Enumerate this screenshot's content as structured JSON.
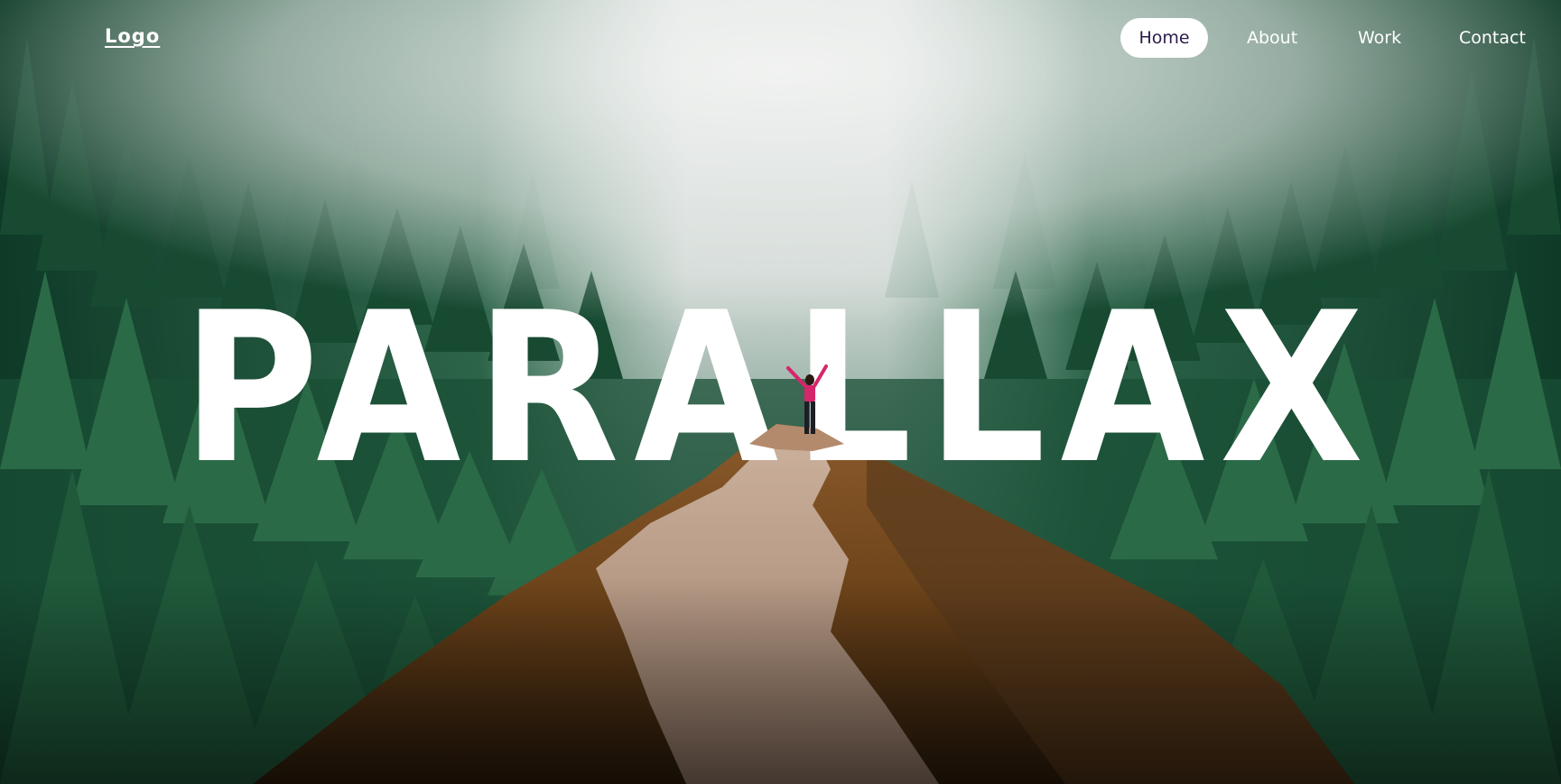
{
  "header": {
    "logo": "Logo",
    "nav": [
      {
        "label": "Home",
        "active": true
      },
      {
        "label": "About",
        "active": false
      },
      {
        "label": "Work",
        "active": false
      },
      {
        "label": "Contact",
        "active": false
      }
    ]
  },
  "hero": {
    "title": "PARALLAX"
  },
  "colors": {
    "title": "#ffffff",
    "nav_active_bg": "#ffffff",
    "nav_active_text": "#2b1a4a",
    "forest_dark": "#0f3a28",
    "forest_mid": "#2e6b4a",
    "mist": "#e6e9e8",
    "mountain": "#7a4e22",
    "trail": "#c9a996",
    "hiker_jacket": "#d6266a"
  },
  "icons": {
    "hiker": "person-arms-raised-figure"
  }
}
